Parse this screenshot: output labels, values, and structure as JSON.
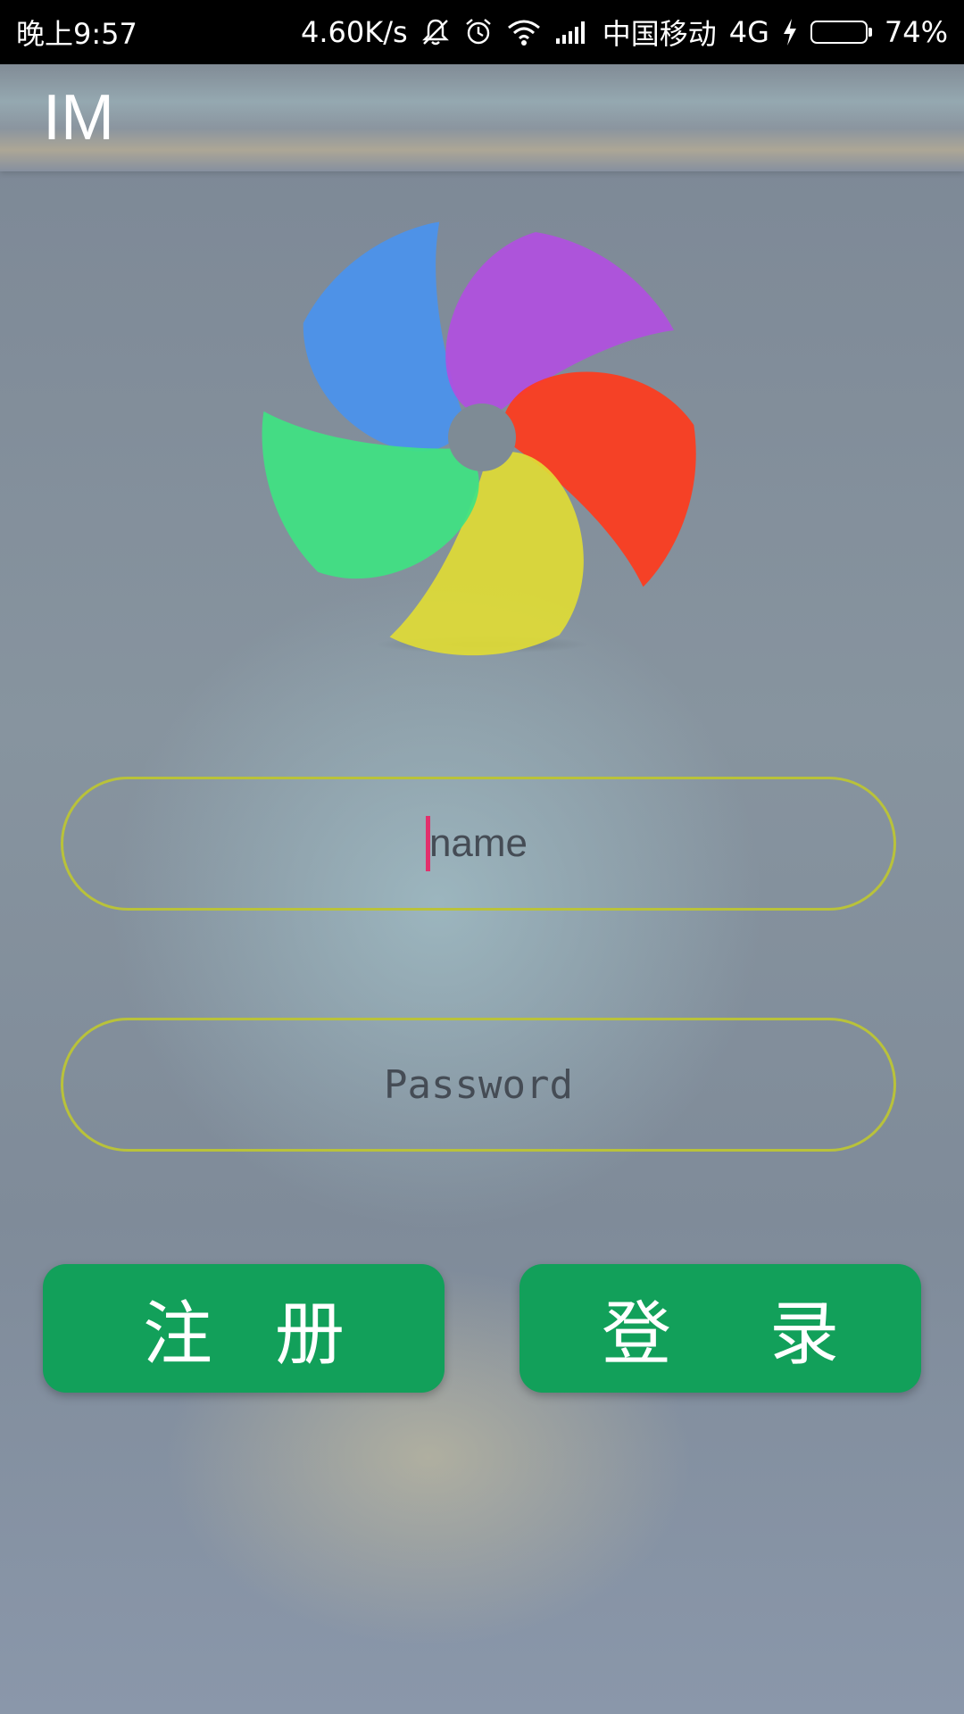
{
  "status_bar": {
    "time": "晚上9:57",
    "network_speed": "4.60K/s",
    "carrier": "中国移动",
    "network_type": "4G",
    "battery_percent": "74%",
    "battery_level": 0.74,
    "battery_color": "#5ed225"
  },
  "app_bar": {
    "title": "IM"
  },
  "logo": {
    "icon": "pinwheel-logo-icon",
    "colors": [
      "#4a92ee",
      "#b14fdf",
      "#ff3b1c",
      "#e0db35",
      "#3fe382"
    ]
  },
  "form": {
    "name_placeholder": "name",
    "password_placeholder": "Password",
    "field_border_color": "#b9c23a",
    "caret_color": "#e2306c"
  },
  "buttons": {
    "register_char1": "注",
    "register_char2": "册",
    "login_char1": "登",
    "login_char2": "录",
    "color": "#12a05a"
  }
}
